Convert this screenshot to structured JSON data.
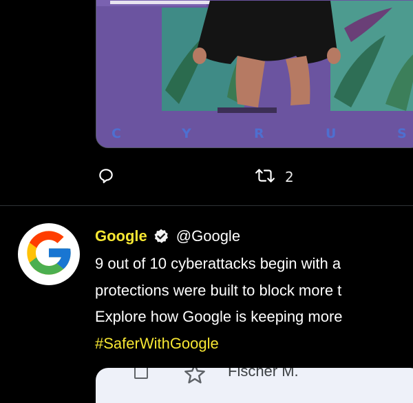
{
  "media": {
    "banner_letters": [
      "C",
      "Y",
      "R",
      "U",
      "S"
    ]
  },
  "actions": {
    "reply_icon": "reply-icon",
    "retweet_icon": "retweet-icon",
    "retweet_count": "2"
  },
  "tweet": {
    "display_name": "Google",
    "handle": "@Google",
    "verified_icon": "verified-badge-icon",
    "avatar_icon": "google-g-logo-icon",
    "lines": [
      "9 out of 10 cyberattacks begin with a",
      "protections were built to block more t",
      "Explore how Google is keeping more"
    ],
    "hashtag": "#SaferWithGoogle"
  },
  "embed": {
    "sender": "Fischer M.",
    "checkbox_icon": "checkbox-icon",
    "star_icon": "star-icon"
  },
  "colors": {
    "background": "#000000",
    "accent_yellow": "#f7e733",
    "divider": "#2f3336",
    "card_purple": "#6b54a0",
    "embed_bg": "#eef1f9"
  }
}
